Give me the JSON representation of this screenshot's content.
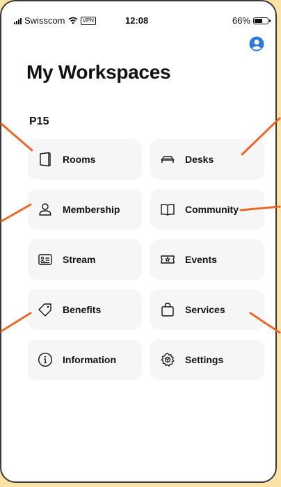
{
  "status_bar": {
    "carrier": "Swisscom",
    "vpn": "VPN",
    "time": "12:08",
    "battery": "66%",
    "battery_level": 0.66
  },
  "header": {
    "title": "My Workspaces"
  },
  "section": {
    "title": "P15"
  },
  "tiles": [
    {
      "label": "Rooms",
      "icon": "door-icon"
    },
    {
      "label": "Desks",
      "icon": "desk-icon"
    },
    {
      "label": "Membership",
      "icon": "person-icon"
    },
    {
      "label": "Community",
      "icon": "book-icon"
    },
    {
      "label": "Stream",
      "icon": "id-card-icon"
    },
    {
      "label": "Events",
      "icon": "star-ticket-icon"
    },
    {
      "label": "Benefits",
      "icon": "tag-icon"
    },
    {
      "label": "Services",
      "icon": "bag-icon"
    },
    {
      "label": "Information",
      "icon": "info-icon"
    },
    {
      "label": "Settings",
      "icon": "gear-icon"
    }
  ],
  "colors": {
    "background": "#fbe3a8",
    "arrow": "#e8682a",
    "tile": "#f6f6f6",
    "accent": "#2f7ad9"
  }
}
